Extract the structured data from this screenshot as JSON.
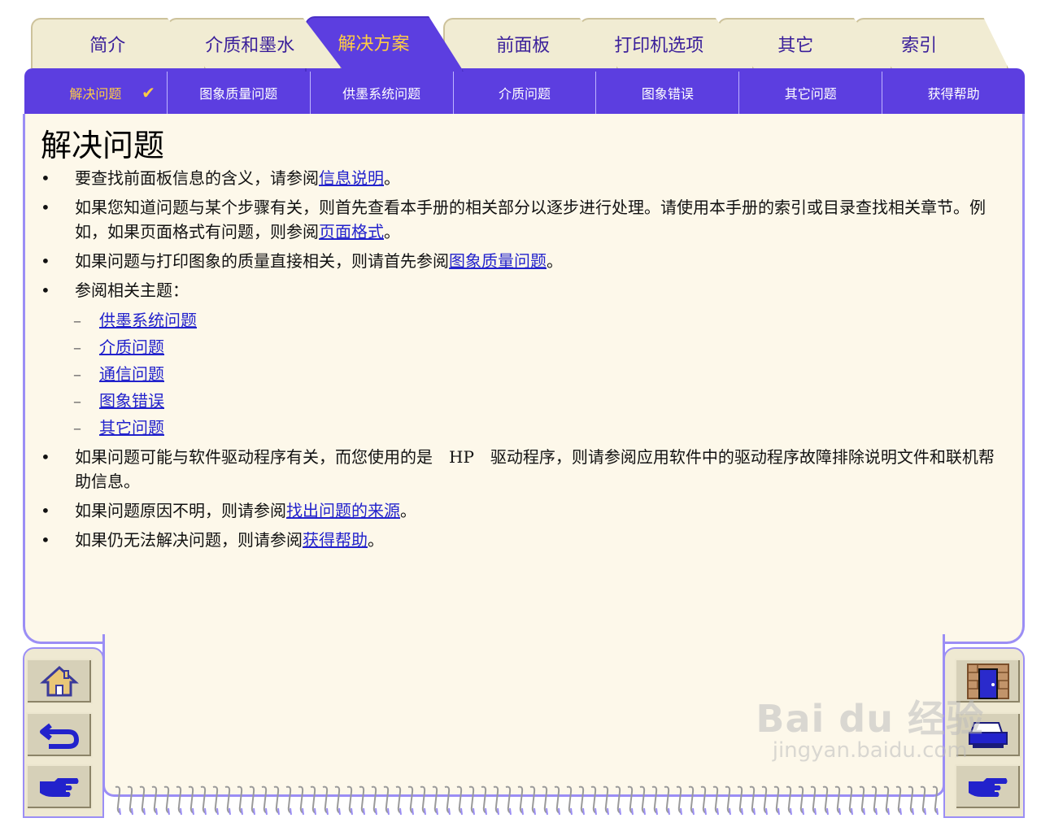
{
  "tabs": [
    {
      "label": "简介",
      "active": false
    },
    {
      "label": "介质和墨水",
      "active": false
    },
    {
      "label": "解决方案",
      "active": true
    },
    {
      "label": "前面板",
      "active": false
    },
    {
      "label": "打印机选项",
      "active": false
    },
    {
      "label": "其它",
      "active": false
    },
    {
      "label": "索引",
      "active": false
    }
  ],
  "subnav": [
    {
      "label": "解决问题",
      "active": true,
      "check": "✔"
    },
    {
      "label": "图象质量问题"
    },
    {
      "label": "供墨系统问题"
    },
    {
      "label": "介质问题"
    },
    {
      "label": "图象错误"
    },
    {
      "label": "其它问题"
    },
    {
      "label": "获得帮助"
    }
  ],
  "page_title": "解决问题",
  "bullets": {
    "b1": {
      "pre": "要查找前面板信息的含义，请参阅",
      "link": "信息说明",
      "post": "。"
    },
    "b2": {
      "pre": "如果您知道问题与某个步骤有关，则首先查看本手册的相关部分以逐步进行处理。请使用本手册的索引或目录查找相关章节。例如，如果页面格式有问题，则参阅",
      "link": "页面格式",
      "post": "。"
    },
    "b3": {
      "pre": "如果问题与打印图象的质量直接相关，则请首先参阅",
      "link": "图象质量问题",
      "post": "。"
    },
    "b4": {
      "text": "参阅相关主题："
    },
    "b5": {
      "text": "如果问题可能与软件驱动程序有关，而您使用的是　HP　驱动程序，则请参阅应用软件中的驱动程序故障排除说明文件和联机帮助信息。"
    },
    "b6": {
      "pre": "如果问题原因不明，则请参阅",
      "link": "找出问题的来源",
      "post": "。"
    },
    "b7": {
      "pre": "如果仍无法解决问题，则请参阅",
      "link": "获得帮助",
      "post": "。"
    }
  },
  "related_topics": [
    "供墨系统问题",
    "介质问题",
    "通信问题",
    "图象错误",
    "其它问题"
  ],
  "left_buttons": [
    "home-icon",
    "back-arrow-icon",
    "next-hand-icon"
  ],
  "right_buttons": [
    "door-exit-icon",
    "printer-icon",
    "next-hand-icon"
  ],
  "watermark": {
    "main": "Bai du 经验",
    "sub": "jingyan.baidu.com"
  },
  "colors": {
    "accent": "#5c3ee0",
    "active_text": "#ffcc44",
    "panel_bg": "#fdf8ea",
    "link": "#2222cc"
  }
}
